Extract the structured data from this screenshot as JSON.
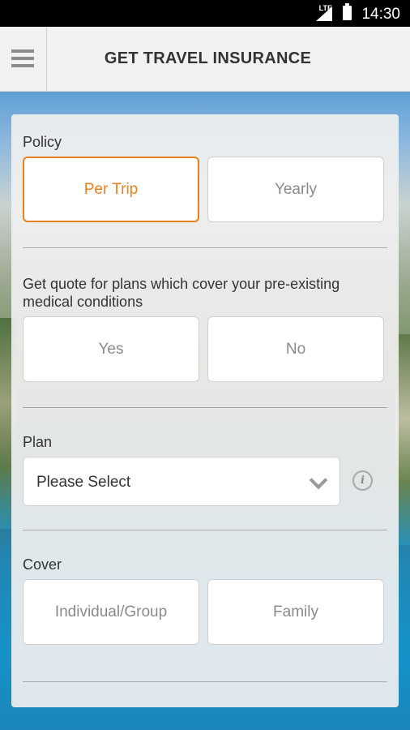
{
  "status_bar": {
    "network": "LTE",
    "time": "14:30"
  },
  "app_bar": {
    "title": "GET TRAVEL INSURANCE"
  },
  "form": {
    "policy": {
      "label": "Policy",
      "options": [
        "Per Trip",
        "Yearly"
      ],
      "selected": "Per Trip"
    },
    "pre_existing": {
      "label": "Get quote for plans which cover your pre-existing medical conditions",
      "options": [
        "Yes",
        "No"
      ]
    },
    "plan": {
      "label": "Plan",
      "value": "Please Select"
    },
    "cover": {
      "label": "Cover",
      "options": [
        "Individual/Group",
        "Family"
      ]
    }
  },
  "colors": {
    "accent": "#e8801e",
    "text": "#333333",
    "muted": "#8a8a8a"
  },
  "icons": [
    "menu-icon",
    "signal-icon",
    "battery-icon",
    "chevron-down-icon",
    "info-icon"
  ]
}
